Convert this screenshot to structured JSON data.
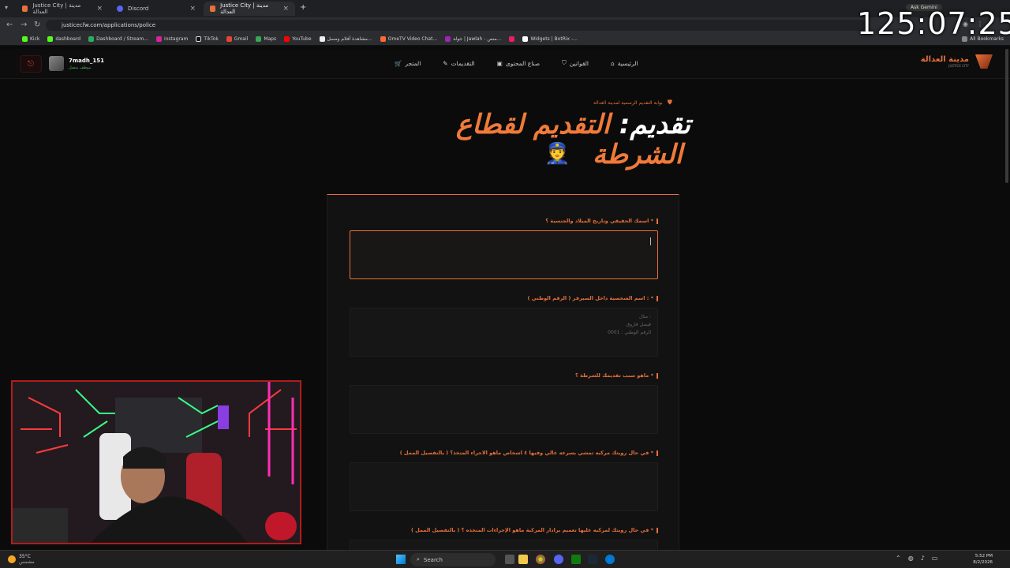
{
  "browser": {
    "tabs": [
      {
        "title": "Justice City | مدينة العدالة",
        "active": false
      },
      {
        "title": "Discord",
        "active": false
      },
      {
        "title": "Justice City | مدينة العدالة",
        "active": true
      }
    ],
    "url": "justicecfw.com/applications/police",
    "bookmarks": [
      "Kick",
      "dashboard",
      "Dashboard / Stream...",
      "instagram",
      "TikTok",
      "Gmail",
      "Maps",
      "YouTube",
      "مشاهدة أفلام ومسل...",
      "OmeTV Video Chat...",
      "جولة | Jawlah - منص...",
      "",
      "Widgets | BotRix -..."
    ],
    "all_bookmarks": "All Bookmarks",
    "ask_gemini": "Ask Gemini"
  },
  "site": {
    "username": "7madh_151",
    "user_status": "موظف متصل",
    "nav": [
      "الرئيسية",
      "القوانين",
      "صناع المحتوى",
      "التقديمات",
      "المتجر"
    ],
    "brand": "مدينة العدالة",
    "brand_sub": "JUSTICE CITY"
  },
  "page": {
    "portal_tag": "بوابة التقديم الرسمية لمدينة العدالة",
    "title_white": "تقديم:",
    "title_orange_1": "التقديم لقطاع",
    "title_orange_2": "الشرطة",
    "emoji": "👮"
  },
  "form": {
    "questions": [
      {
        "label": "اسمك الحقيقي وتاريخ الميلاد والجنسية ؟ *",
        "placeholder": ""
      },
      {
        "label": "اسم الشخصية داخل السيرفر ( الرقم الوطني ) : *",
        "placeholder": "مثال :\nفيصل فاروق\nالرقم الوطني : 0001"
      },
      {
        "label": "ماهو سبب تقديمك للشرطة ؟ *",
        "placeholder": ""
      },
      {
        "label": "في حال رويتك مركبه تمشي بسرعه عالي وفيها ٤ اشخاص ماهو الاجراء المتخذ؟ ( بالتفصيل الممل ) *",
        "placeholder": ""
      },
      {
        "label": "في حال رويتك لمركبه عليها تعميم برادار المركبة ماهو الإجراءات المتخذه ؟ ( بالتفصيل الممل ) *",
        "placeholder": ""
      }
    ]
  },
  "overlay": {
    "timer": "125:07:25"
  },
  "taskbar": {
    "weather_temp": "35°C",
    "weather_desc": "مشمس",
    "search": "Search",
    "time": "5:52 PM",
    "date": "8/2/2026"
  },
  "colors": {
    "accent": "#e8703a",
    "background": "#0b0b0b"
  }
}
